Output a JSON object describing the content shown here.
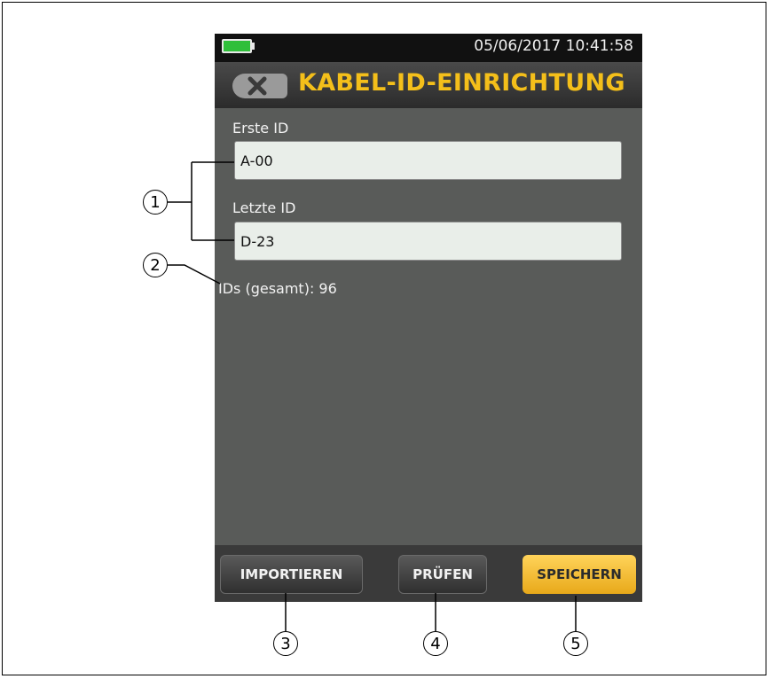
{
  "status": {
    "datetime": "05/06/2017 10:41:58",
    "battery_color": "#2fbf3a"
  },
  "header": {
    "title": "KABEL-ID-EINRICHTUNG",
    "close_icon": "close-x-icon"
  },
  "form": {
    "first_id_label": "Erste ID",
    "first_id_value": "A-00",
    "last_id_label": "Letzte ID",
    "last_id_value": "D-23",
    "total_text": "IDs (gesamt): 96"
  },
  "buttons": {
    "import": "IMPORTIEREN",
    "check": "PRÜFEN",
    "save": "SPEICHERN"
  },
  "callouts": {
    "c1": "1",
    "c2": "2",
    "c3": "3",
    "c4": "4",
    "c5": "5"
  },
  "colors": {
    "title": "#f4bf1a",
    "save_button": "#f5b82a",
    "screen_bg": "#595b59"
  }
}
